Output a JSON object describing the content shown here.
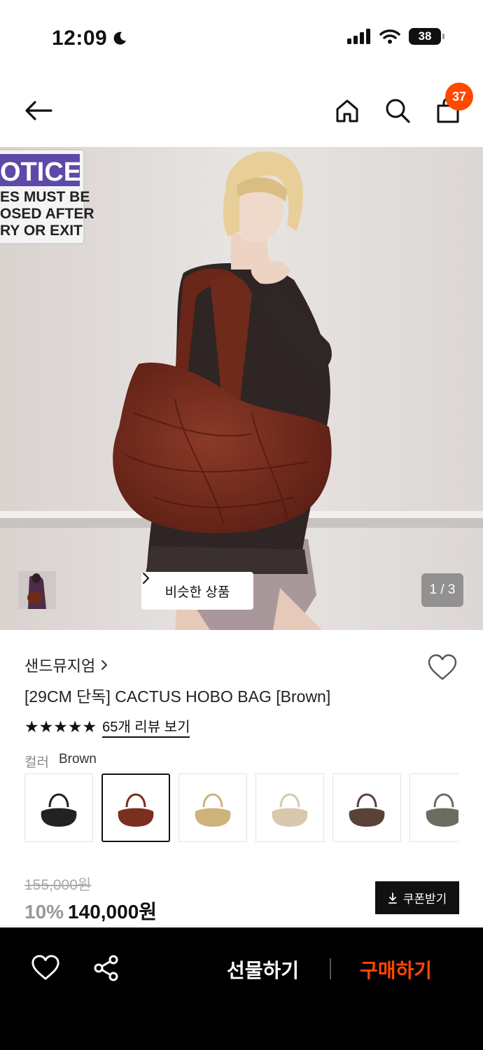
{
  "status_bar": {
    "time": "12:09",
    "battery": "38"
  },
  "nav": {
    "cart_count": "37"
  },
  "gallery": {
    "similar_button_label": "비슷한 상품",
    "page_counter": "1 / 3",
    "sign_lines": [
      "OTICE",
      "ES MUST BE",
      "OSED AFTER",
      "RY OR EXIT"
    ]
  },
  "product": {
    "brand": "샌드뮤지엄",
    "title": "[29CM 단독] CACTUS HOBO BAG [Brown]",
    "stars": "★★★★★",
    "review_link": "65개 리뷰 보기",
    "color_label": "컬러",
    "color_value": "Brown",
    "swatch_colors": [
      "#222222",
      "#7a2f1f",
      "#cdb27a",
      "#d8c8ad",
      "#5a4238",
      "#6a6e5e"
    ],
    "original_price": "155,000원",
    "discount": "10%",
    "price": "140,000원",
    "coupon_label": "쿠폰받기"
  },
  "bottom_bar": {
    "gift_label": "선물하기",
    "buy_label": "구매하기"
  },
  "colors": {
    "accent": "#ff4800",
    "bag": "#7a2f1f"
  }
}
